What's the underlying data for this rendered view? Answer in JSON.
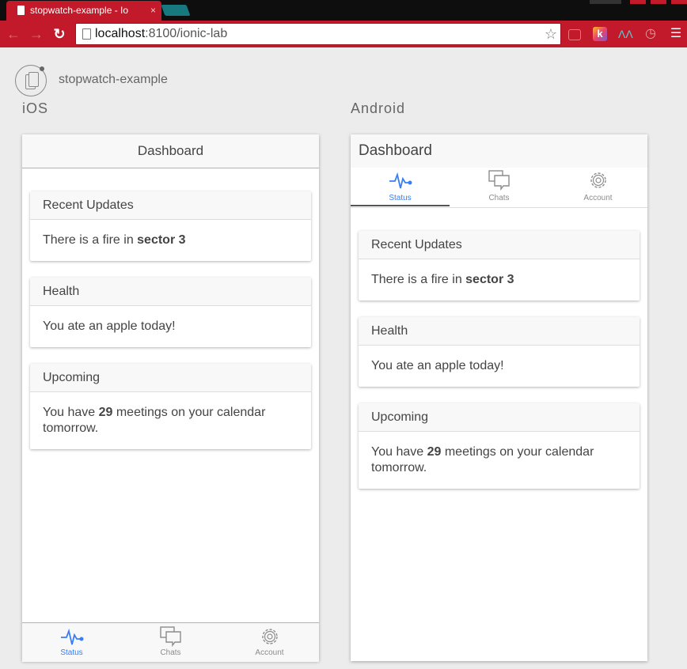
{
  "browser": {
    "tab_title": "stopwatch-example - Io",
    "tab_close": "×",
    "url_host": "localhost",
    "url_path": ":8100/ionic-lab",
    "accent": "#c21a2a"
  },
  "lab": {
    "title": "stopwatch-example",
    "ios_label": "iOS",
    "android_label": "Android"
  },
  "ios": {
    "header": "Dashboard",
    "cards": [
      {
        "title": "Recent Updates",
        "pre": "There is a fire in ",
        "bold": "sector 3",
        "post": ""
      },
      {
        "title": "Health",
        "pre": "You ate an apple today!",
        "bold": "",
        "post": ""
      },
      {
        "title": "Upcoming",
        "pre": "You have ",
        "bold": "29",
        "post": " meetings on your calendar tomorrow."
      }
    ],
    "tabs": [
      {
        "label": "Status",
        "icon": "pulse-icon",
        "active": true
      },
      {
        "label": "Chats",
        "icon": "chat-bubbles-icon",
        "active": false
      },
      {
        "label": "Account",
        "icon": "gear-icon",
        "active": false
      }
    ]
  },
  "android": {
    "header": "Dashboard",
    "cards": [
      {
        "title": "Recent Updates",
        "pre": "There is a fire in ",
        "bold": "sector 3",
        "post": ""
      },
      {
        "title": "Health",
        "pre": "You ate an apple today!",
        "bold": "",
        "post": ""
      },
      {
        "title": "Upcoming",
        "pre": "You have ",
        "bold": "29",
        "post": " meetings on your calendar tomorrow."
      }
    ],
    "tabs": [
      {
        "label": "Status",
        "icon": "pulse-icon",
        "active": true
      },
      {
        "label": "Chats",
        "icon": "chat-bubbles-icon",
        "active": false
      },
      {
        "label": "Account",
        "icon": "gear-icon",
        "active": false
      }
    ]
  },
  "colors": {
    "active_tab": "#387ef5",
    "inactive_tab": "#8c8c8c"
  }
}
